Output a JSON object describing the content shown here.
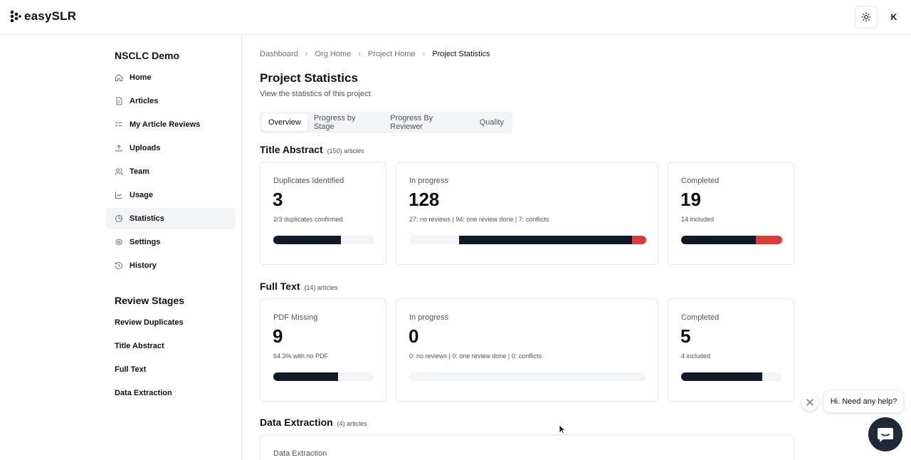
{
  "app": {
    "name": "easySLR",
    "avatar_initial": "K"
  },
  "sidebar": {
    "project_title": "NSCLC Demo",
    "items": [
      {
        "label": "Home",
        "icon": "home-icon"
      },
      {
        "label": "Articles",
        "icon": "file-icon"
      },
      {
        "label": "My Article Reviews",
        "icon": "checklist-icon"
      },
      {
        "label": "Uploads",
        "icon": "upload-icon"
      },
      {
        "label": "Team",
        "icon": "users-icon"
      },
      {
        "label": "Usage",
        "icon": "chart-line-icon"
      },
      {
        "label": "Statistics",
        "icon": "pie-chart-icon",
        "active": true
      },
      {
        "label": "Settings",
        "icon": "gear-icon"
      },
      {
        "label": "History",
        "icon": "history-icon"
      }
    ],
    "stages_title": "Review Stages",
    "stages": [
      "Review Duplicates",
      "Title Abstract",
      "Full Text",
      "Data Extraction"
    ]
  },
  "breadcrumb": [
    "Dashboard",
    "Org Home",
    "Project Home",
    "Project Statistics"
  ],
  "page": {
    "title": "Project Statistics",
    "subtitle": "View the statistics of this project"
  },
  "tabs": [
    "Overview",
    "Progress by Stage",
    "Progress By Reviewer",
    "Quality"
  ],
  "sections": {
    "title_abstract": {
      "title": "Title Abstract",
      "count": "(150) articles",
      "cards": [
        {
          "label": "Duplicates Identified",
          "value": "3",
          "sub": "2/3 duplicates confirmed",
          "progress": [
            0.67
          ]
        },
        {
          "label": "In progress",
          "value": "128",
          "sub": "27: no reviews | 94: one review done | 7: conflicts",
          "progress": [
            0.21,
            0.73,
            0.06
          ]
        },
        {
          "label": "Completed",
          "value": "19",
          "sub": "14 included",
          "progress": [
            0.74,
            0.26
          ]
        }
      ]
    },
    "full_text": {
      "title": "Full Text",
      "count": "(14) articles",
      "cards": [
        {
          "label": "PDF Missing",
          "value": "9",
          "sub": "64.3% with no PDF",
          "progress": [
            0.643
          ]
        },
        {
          "label": "In progress",
          "value": "0",
          "sub": "0: no reviews | 0: one review done | 0: conflicts",
          "progress": [
            0,
            0,
            0
          ]
        },
        {
          "label": "Completed",
          "value": "5",
          "sub": "4 included",
          "progress": [
            0.8
          ]
        }
      ]
    },
    "data_extraction": {
      "title": "Data Extraction",
      "count": "(4) articles",
      "card_label": "Data Extraction"
    }
  },
  "chat": {
    "bubble_text": "Hi. Need any help?"
  },
  "colors": {
    "bar_dark": "#111827",
    "bar_red": "#dc3b3b",
    "bar_track": "#f3f4f6"
  }
}
